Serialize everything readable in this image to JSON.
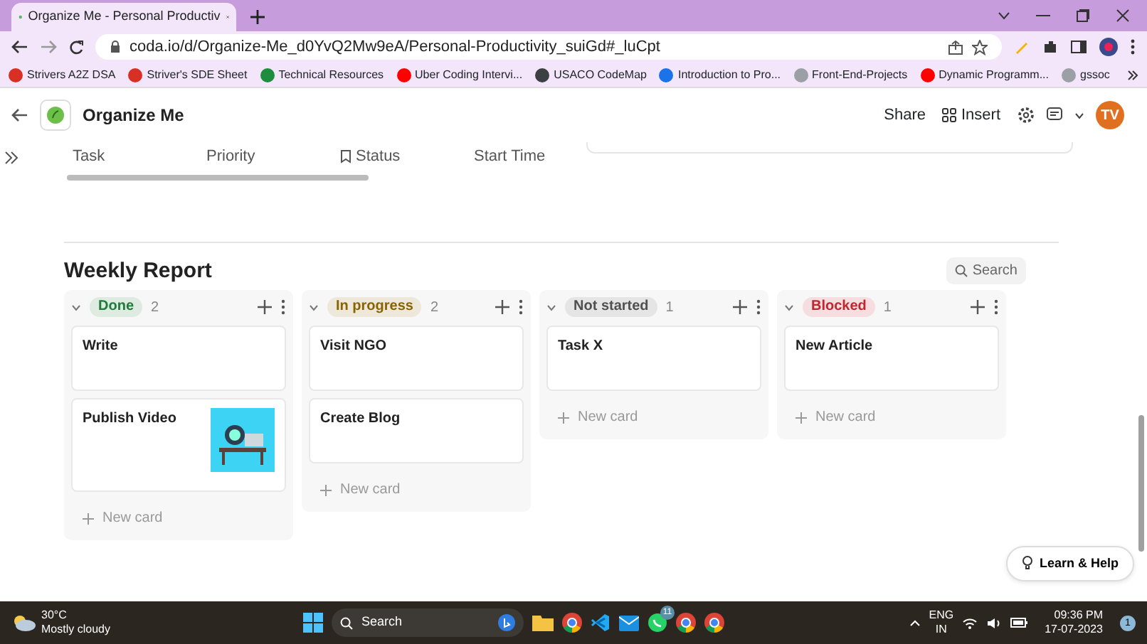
{
  "browser": {
    "tab_title": "Organize Me - Personal Productiv",
    "url": "coda.io/d/Organize-Me_d0YvQ2Mw9eA/Personal-Productivity_suiGd#_luCpt",
    "bookmarks": [
      {
        "label": "Strivers A2Z DSA",
        "color": "#d93025"
      },
      {
        "label": "Striver's SDE Sheet",
        "color": "#d93025"
      },
      {
        "label": "Technical Resources",
        "color": "#1e8e3e"
      },
      {
        "label": "Uber Coding Intervi...",
        "color": "#ff0000"
      },
      {
        "label": "USACO CodeMap",
        "color": "#3c4043"
      },
      {
        "label": "Introduction to Pro...",
        "color": "#1a73e8"
      },
      {
        "label": "Front-End-Projects",
        "color": "#9aa0a6"
      },
      {
        "label": "Dynamic Programm...",
        "color": "#ff0000"
      },
      {
        "label": "gssoc",
        "color": "#9aa0a6"
      }
    ]
  },
  "doc": {
    "title": "Organize Me",
    "actions": [
      "Share",
      "Insert"
    ],
    "avatar": "TV"
  },
  "table": {
    "columns": [
      "Task",
      "Priority",
      "Status",
      "Start Time"
    ]
  },
  "board": {
    "title": "Weekly Report",
    "search_placeholder": "Search",
    "groups": [
      {
        "label": "Done",
        "color": "#1e7b3a",
        "count": "2",
        "new_card": "New card",
        "cards": [
          {
            "title": "Write",
            "kind": "plain"
          },
          {
            "title": "Publish Video",
            "kind": "image"
          }
        ]
      },
      {
        "label": "In progress",
        "color": "#8a6300",
        "count": "2",
        "new_card": "New card",
        "cards": [
          {
            "title": "Visit NGO",
            "kind": "plain"
          },
          {
            "title": "Create Blog",
            "kind": "plain"
          }
        ]
      },
      {
        "label": "Not started",
        "color": "#505050",
        "count": "1",
        "new_card": "New card",
        "cards": [
          {
            "title": "Task X",
            "kind": "plain"
          }
        ]
      },
      {
        "label": "Blocked",
        "color": "#c0262d",
        "count": "1",
        "new_card": "New card",
        "cards": [
          {
            "title": "New Article",
            "kind": "plain"
          }
        ]
      }
    ]
  },
  "help_button": "Learn & Help",
  "taskbar": {
    "temperature": "30°C",
    "weather": "Mostly cloudy",
    "search_placeholder": "Search",
    "chat_badge": "11",
    "language": "ENG",
    "region": "IN",
    "time": "09:36 PM",
    "date": "17-07-2023",
    "notifications": "1"
  }
}
